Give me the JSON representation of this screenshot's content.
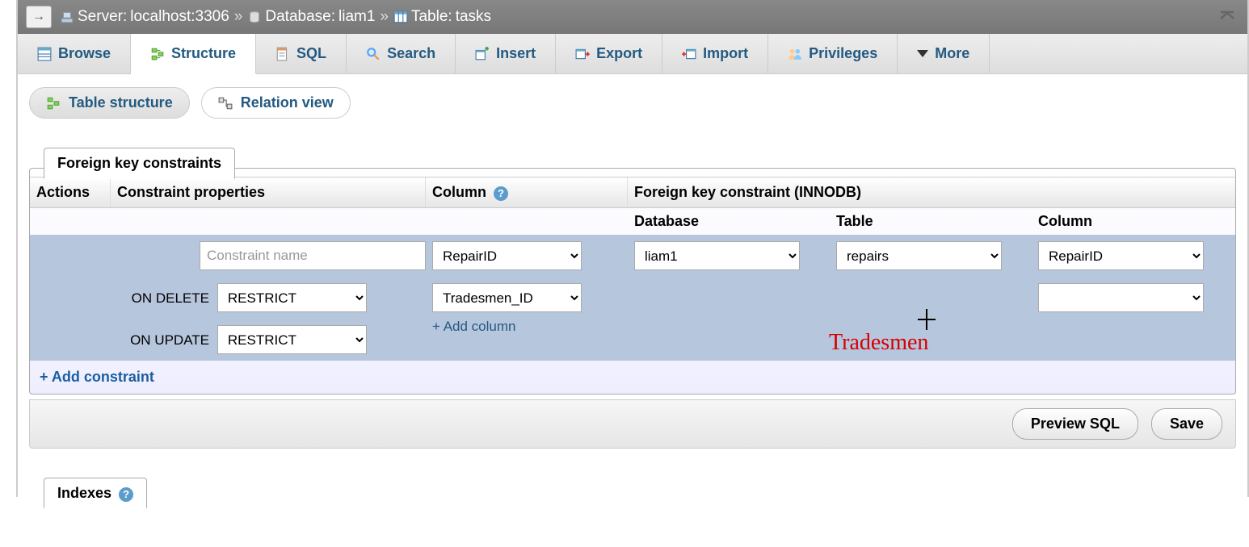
{
  "breadcrumb": {
    "server_prefix": "Server:",
    "server": "localhost:3306",
    "db_prefix": "Database:",
    "db": "liam1",
    "table_prefix": "Table:",
    "table": "tasks"
  },
  "tabs": {
    "browse": "Browse",
    "structure": "Structure",
    "sql": "SQL",
    "search": "Search",
    "insert": "Insert",
    "export": "Export",
    "import": "Import",
    "privileges": "Privileges",
    "more": "More"
  },
  "subtabs": {
    "table_structure": "Table structure",
    "relation_view": "Relation view"
  },
  "fk": {
    "legend": "Foreign key constraints",
    "headers": {
      "actions": "Actions",
      "properties": "Constraint properties",
      "column": "Column",
      "fk": "Foreign key constraint (INNODB)",
      "database": "Database",
      "table": "Table",
      "column2": "Column"
    },
    "constraint_name_placeholder": "Constraint name",
    "on_delete_label": "ON DELETE",
    "on_update_label": "ON UPDATE",
    "restrict": "RESTRICT",
    "col1": "RepairID",
    "col2": "Tradesmen_ID",
    "db_val": "liam1",
    "table_val": "repairs",
    "fk_col_val": "RepairID",
    "fk_col_val2": "",
    "add_column": "+ Add column",
    "add_constraint": "+ Add constraint"
  },
  "buttons": {
    "preview": "Preview SQL",
    "save": "Save"
  },
  "indexes_label": "Indexes",
  "annotation": "Tradesmen"
}
